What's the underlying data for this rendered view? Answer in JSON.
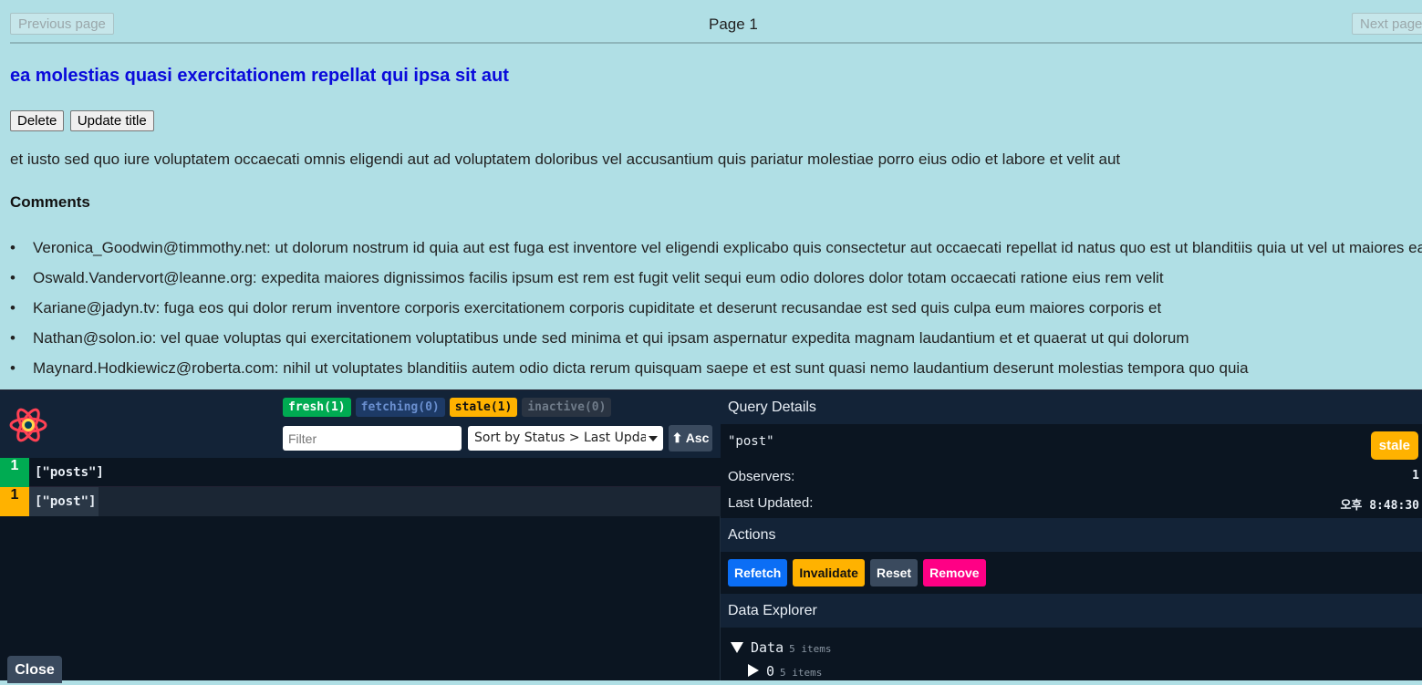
{
  "pager": {
    "prev_label": "Previous page",
    "page_label": "Page 1",
    "next_label": "Next page"
  },
  "post": {
    "title": "ea molestias quasi exercitationem repellat qui ipsa sit aut",
    "delete_label": "Delete",
    "update_label": "Update title",
    "body": "et iusto sed quo iure voluptatem occaecati omnis eligendi aut ad voluptatem doloribus vel accusantium quis pariatur molestiae porro eius odio et labore et velit aut"
  },
  "comments": {
    "heading": "Comments",
    "items": [
      "Veronica_Goodwin@timmothy.net: ut dolorum nostrum id quia aut est fuga est inventore vel eligendi explicabo quis consectetur aut occaecati repellat id natus quo est ut blanditiis quia ut vel ut maiores ea",
      "Oswald.Vandervort@leanne.org: expedita maiores dignissimos facilis ipsum est rem est fugit velit sequi eum odio dolores dolor totam occaecati ratione eius rem velit",
      "Kariane@jadyn.tv: fuga eos qui dolor rerum inventore corporis exercitationem corporis cupiditate et deserunt recusandae est sed quis culpa eum maiores corporis et",
      "Nathan@solon.io: vel quae voluptas qui exercitationem voluptatibus unde sed minima et qui ipsam aspernatur expedita magnam laudantium et et quaerat ut qui dolorum",
      "Maynard.Hodkiewicz@roberta.com: nihil ut voluptates blanditiis autem odio dicta rerum quisquam saepe et est sunt quasi nemo laudantium deserunt molestias tempora quo quia"
    ]
  },
  "devtools": {
    "logo_icon": "react-query-logo-icon",
    "pills": {
      "fresh": "fresh(1)",
      "fetching": "fetching(0)",
      "stale": "stale(1)",
      "inactive": "inactive(0)"
    },
    "filter_placeholder": "Filter",
    "sort_value": "Sort by Status > Last Updated",
    "asc_label": "⬆ Asc",
    "queries": [
      {
        "count": "1",
        "key": "[\"posts\"]",
        "status": "fresh"
      },
      {
        "count": "1",
        "key": "[\"post\"]",
        "status": "stale"
      }
    ],
    "close_label": "Close",
    "details": {
      "heading": "Query Details",
      "query_key": "\"post\"",
      "status_badge": "stale",
      "observers_label": "Observers:",
      "observers_value": "1",
      "last_updated_label": "Last Updated:",
      "last_updated_value": "오후 8:48:30"
    },
    "actions": {
      "heading": "Actions",
      "refetch": "Refetch",
      "invalidate": "Invalidate",
      "reset": "Reset",
      "remove": "Remove"
    },
    "explorer": {
      "heading": "Data Explorer",
      "root_label": "Data",
      "root_meta": "5 items",
      "child_label": "0",
      "child_meta": "5 items"
    },
    "colors": {
      "fresh": "#00ab52",
      "stale": "#ffb200",
      "refetch": "#0b6ef5",
      "remove": "#ff0085",
      "panel_bg": "#0b1521"
    }
  }
}
